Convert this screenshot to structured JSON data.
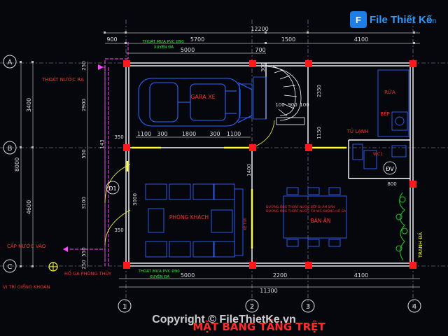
{
  "watermark": {
    "brand": "File Thiết Kế",
    "domain": ".vn",
    "copyright": "Copyright © FileThietKe.vn"
  },
  "drawing_title": "MẶT BẰNG TẦNG TRỆT",
  "axes": {
    "rows": [
      "A",
      "B",
      "C"
    ],
    "cols": [
      "1",
      "2",
      "3",
      "4"
    ]
  },
  "dims": {
    "top_total": "12200",
    "top_segments": [
      "900",
      "5700",
      "1500",
      "4100"
    ],
    "top_inner": [
      "5000",
      "700"
    ],
    "bottom_segments": [
      "5000",
      "2200",
      "4100"
    ],
    "bottom_total": "11300",
    "left_total": "8000",
    "left_segments": [
      "3400",
      "4600"
    ],
    "left_inner": [
      "250",
      "2900",
      "550",
      "3100",
      "550",
      "250"
    ],
    "left_small": [
      "350",
      "350"
    ],
    "garage_row": [
      "1100",
      "300",
      "1800",
      "300",
      "1100"
    ],
    "stair": [
      "100",
      "900",
      "100",
      "2350",
      "1150",
      "300"
    ],
    "living": [
      "1400",
      "3000"
    ],
    "wc_width": "800",
    "misc": [
      "143"
    ]
  },
  "rooms": {
    "garage": "GARA XE",
    "living": "PHÒNG KHÁCH",
    "dining": "BÀN ĂN",
    "sink": "RỬA",
    "stove": "BẾP",
    "fridge": "TỦ LẠNH",
    "wc": "WC1",
    "tree": "TRANH ĐÁ",
    "shelf": "KỆ TIVI"
  },
  "notes": {
    "downpipe_top": "THOÁT MƯA PVC Ø90\nXUYÊN ĐÀ",
    "downpipe_bottom": "THOÁT MƯA PVC Ø90\nXUYÊN ĐÀ",
    "drain_out": "THOÁT NƯỚC RA",
    "water_in": "CẤP NƯỚC VÀO",
    "well": "VỊ TRÍ GIẾNG KHOAN",
    "hole": "HỐ GA PHÒNG THỦY",
    "red_note": "ĐƯỜNG ỐNG THOÁT NƯỚC BẾP ĐI ÂM SÀN\nĐƯỜNG ỐNG THOÁT NƯỚC TỪ WC XUỐNG HỐ GA"
  },
  "symbols": {
    "d1": "Đ1",
    "dv": "ĐV"
  },
  "colors": {
    "background": "#05070c",
    "wall": "#ffffff",
    "column": "#ff1a1a",
    "dimension": "#cfcfcf",
    "axis": "#e8e8e8",
    "furniture": "#2f64ff",
    "door": "#ffff33",
    "note_green": "#22ff22",
    "pipe": "#ff44ff",
    "accent_red": "#ff2a2a",
    "plant": "#22cc22",
    "title": "#ff2a2a",
    "watermark": "#2a9bff"
  }
}
